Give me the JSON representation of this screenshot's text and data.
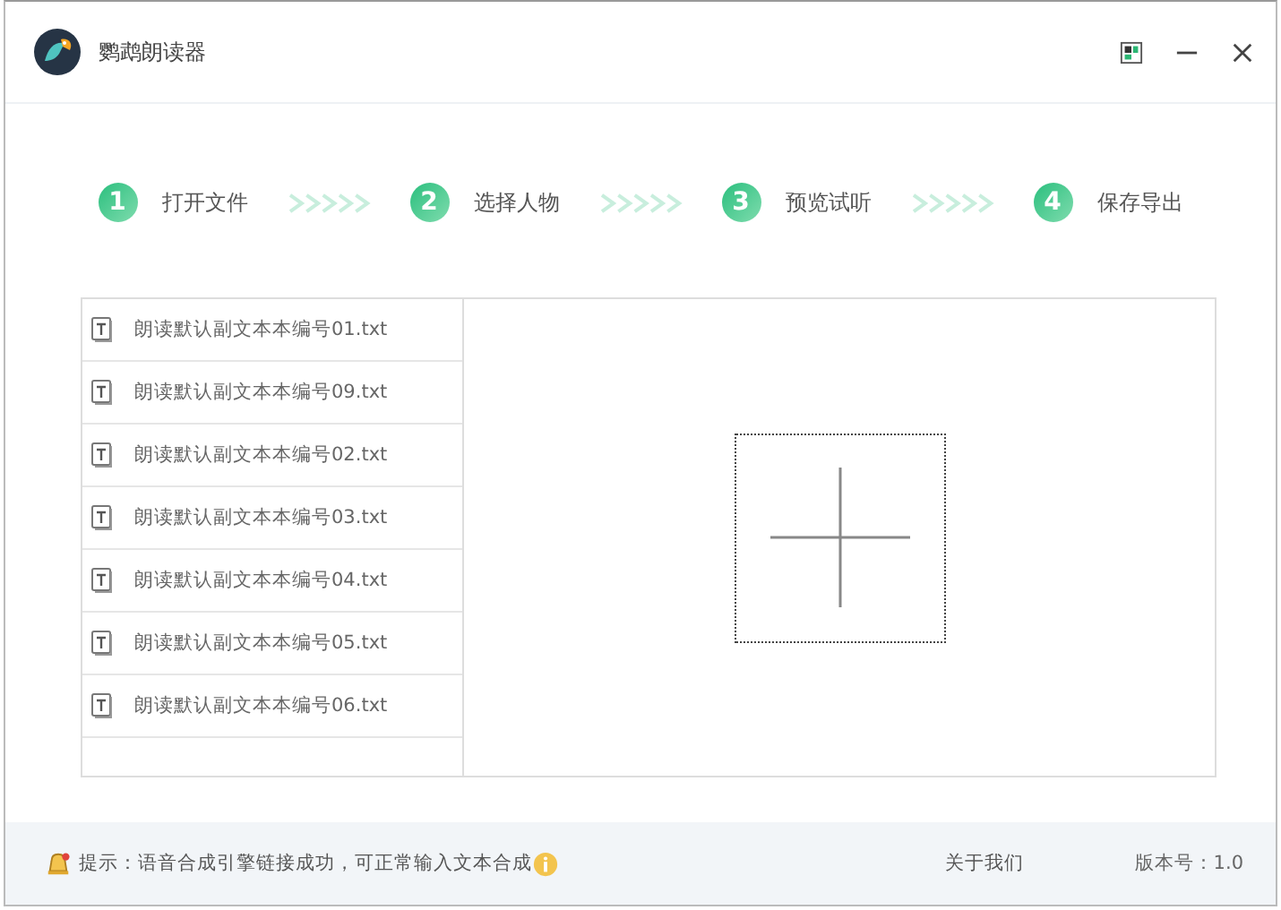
{
  "window": {
    "title": "鹦鹉朗读器"
  },
  "steps": [
    {
      "number": "1",
      "label": "打开文件"
    },
    {
      "number": "2",
      "label": "选择人物"
    },
    {
      "number": "3",
      "label": "预览试听"
    },
    {
      "number": "4",
      "label": "保存导出"
    }
  ],
  "files": [
    {
      "name": "朗读默认副文本本编号01.txt"
    },
    {
      "name": "朗读默认副文本本编号09.txt"
    },
    {
      "name": "朗读默认副文本本编号02.txt"
    },
    {
      "name": "朗读默认副文本本编号03.txt"
    },
    {
      "name": "朗读默认副文本本编号04.txt"
    },
    {
      "name": "朗读默认副文本本编号05.txt"
    },
    {
      "name": "朗读默认副文本本编号06.txt"
    }
  ],
  "status_bar": {
    "message": "提示：语音合成引擎链接成功，可正常输入文本合成",
    "about": "关于我们",
    "version": "版本号：1.0"
  }
}
